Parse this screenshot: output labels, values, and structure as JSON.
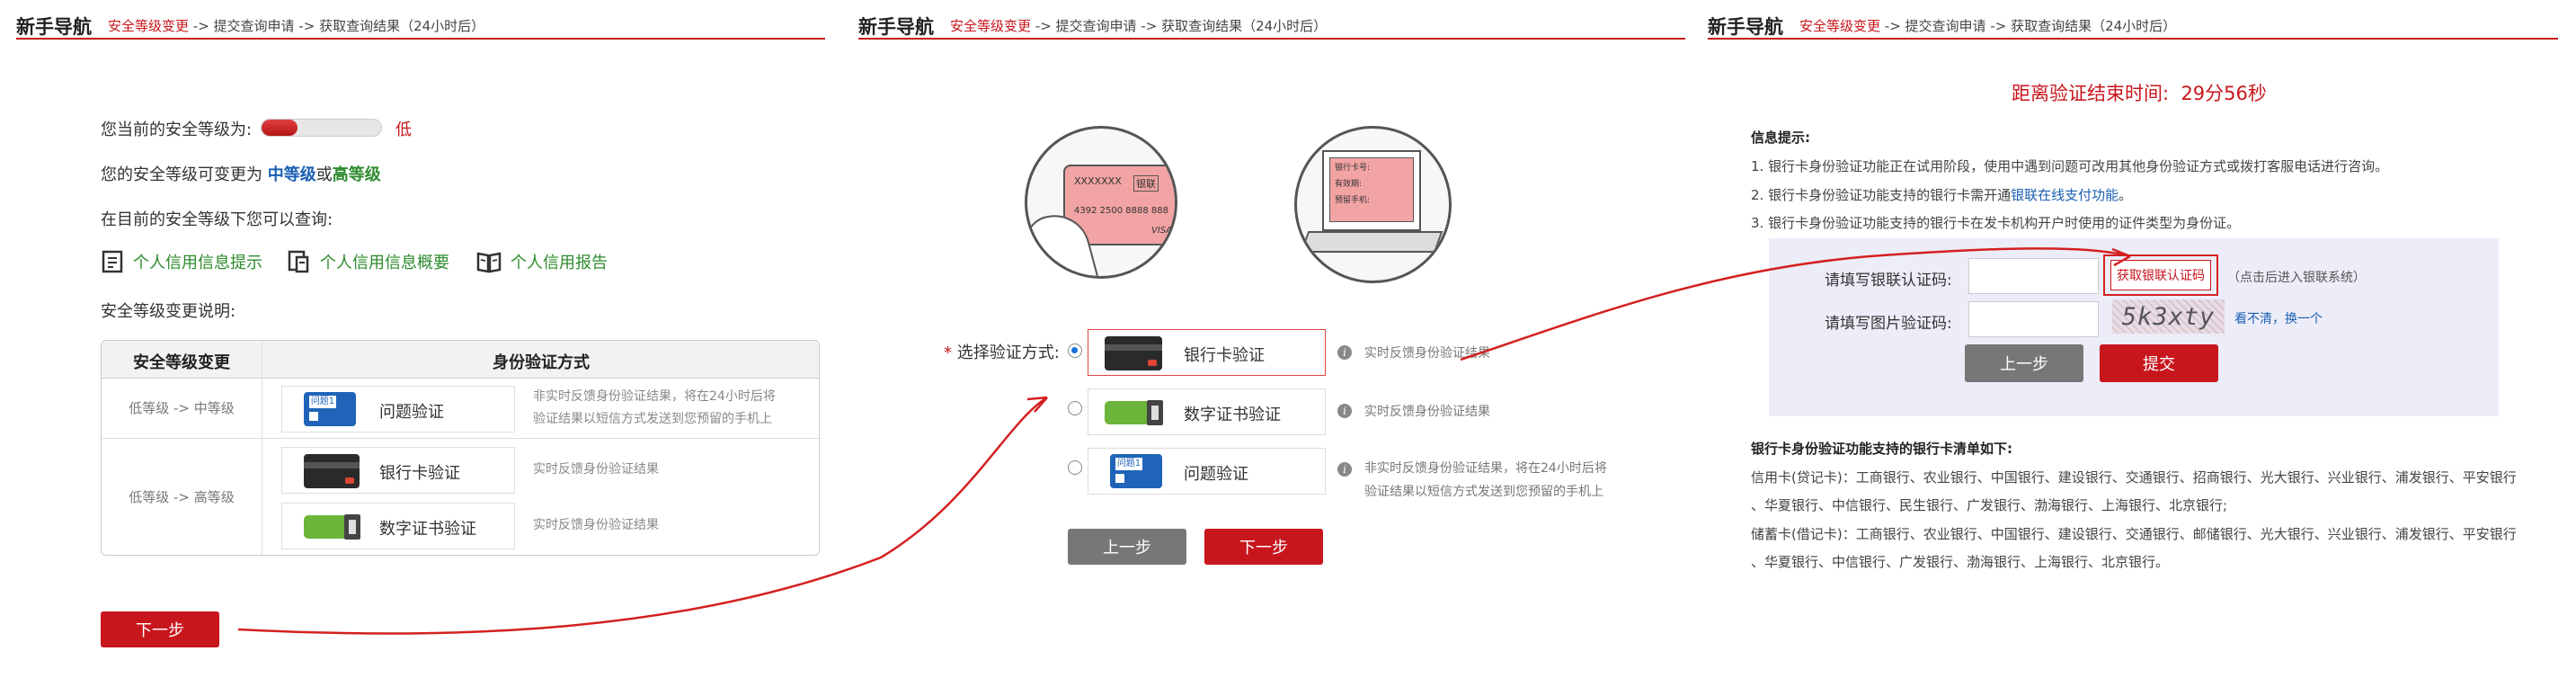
{
  "nav": {
    "title": "新手导航",
    "step1": "安全等级变更",
    "arrow1": " -> ",
    "step2": "提交查询申请",
    "arrow2": " -> ",
    "step3": "获取查询结果（24小时后）"
  },
  "panel1": {
    "current_level_label": "您当前的安全等级为:",
    "current_level_value": "低",
    "level_meter_fraction": 0.3,
    "change_prefix": "您的安全等级可变更为",
    "mid_level": "中等级",
    "or": "或",
    "high_level": "高等级",
    "query_label": "在目前的安全等级下您可以查询:",
    "links": [
      "个人信用信息提示",
      "个人信用信息概要",
      "个人信用报告"
    ],
    "desc_label": "安全等级变更说明:",
    "table": {
      "col1": "安全等级变更",
      "col2": "身份验证方式",
      "row1": {
        "from": "低等级",
        "arrow": "->",
        "to": "中等级",
        "method": "问题验证",
        "note_line1": "非实时反馈身份验证结果，将在24小时后将",
        "note_line2": "验证结果以短信方式发送到您预留的手机上"
      },
      "row2": {
        "from": "低等级",
        "arrow": "->",
        "to": "高等级",
        "methods": [
          {
            "label": "银行卡验证",
            "note": "实时反馈身份验证结果"
          },
          {
            "label": "数字证书验证",
            "note": "实时反馈身份验证结果"
          }
        ]
      }
    },
    "next_button": "下一步",
    "icon_question_text": "问题1"
  },
  "panel2": {
    "card_illustration": {
      "card_number_top": "XXXXXXX",
      "card_bank": "银联",
      "card_number": "4392 2500 8888 888",
      "card_brand": "VISA"
    },
    "form_illustration": {
      "line1": "银行卡号:",
      "line2": "有效期:",
      "line3": "预留手机:"
    },
    "required_mark": "*",
    "select_label": "选择验证方式:",
    "options": [
      {
        "label": "银行卡验证",
        "note": "实时反馈身份验证结果",
        "selected": true
      },
      {
        "label": "数字证书验证",
        "note": "实时反馈身份验证结果",
        "selected": false
      },
      {
        "label": "问题验证",
        "note_line1": "非实时反馈身份验证结果，将在24小时后将",
        "note_line2": "验证结果以短信方式发送到您预留的手机上",
        "selected": false
      }
    ],
    "prev_button": "上一步",
    "next_button": "下一步"
  },
  "panel3": {
    "countdown_label": "距离验证结束时间:",
    "countdown_value": "29分56秒",
    "info_title": "信息提示:",
    "info1": "1. 银行卡身份验证功能正在试用阶段，使用中遇到问题可改用其他身份验证方式或拨打客服电话进行咨询。",
    "info2_prefix": "2. 银行卡身份验证功能支持的银行卡需开通",
    "info2_link": "银联在线支付功能",
    "info2_suffix": "。",
    "info3": "3. 银行卡身份验证功能支持的银行卡在发卡机构开户时使用的证件类型为身份证。",
    "unionpay_code_label": "请填写银联认证码:",
    "unionpay_code_value": "",
    "get_code_button": "获取银联认证码",
    "get_code_hint": "（点击后进入银联系统）",
    "captcha_label": "请填写图片验证码:",
    "captcha_value": "",
    "captcha_text": "5k3xty",
    "captcha_refresh": "看不清，换一个",
    "prev_button": "上一步",
    "submit_button": "提交",
    "banks_title": "银行卡身份验证功能支持的银行卡清单如下:",
    "credit_line1": "信用卡(贷记卡)：工商银行、农业银行、中国银行、建设银行、交通银行、招商银行、光大银行、兴业银行、浦发银行、平安银行",
    "credit_line2": "、华夏银行、中信银行、民生银行、广发银行、渤海银行、上海银行、北京银行;",
    "debit_line1": "储蓄卡(借记卡)：工商银行、农业银行、中国银行、建设银行、交通银行、邮储银行、光大银行、兴业银行、浦发银行、平安银行",
    "debit_line2": "、华夏银行、中信银行、广发银行、渤海银行、上海银行、北京银行。"
  },
  "colors": {
    "brand_red": "#c8161d",
    "link_blue": "#1a5fb4",
    "link_green": "#2e8b2e",
    "panel_bg": "#ecedf8"
  }
}
